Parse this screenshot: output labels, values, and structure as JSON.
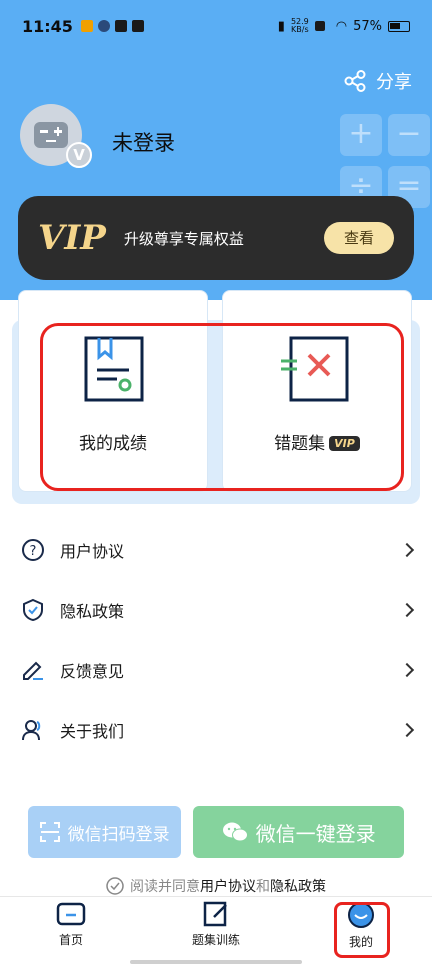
{
  "status": {
    "time": "11:45",
    "speed": "52.9\nKB/s",
    "battery": "57%"
  },
  "header": {
    "share_label": "分享",
    "username": "未登录",
    "avatar_badge": "V"
  },
  "vip_banner": {
    "logo": "VIP",
    "description": "升级尊享专属权益",
    "button": "查看"
  },
  "cards": [
    {
      "label": "我的成绩"
    },
    {
      "label": "错题集",
      "badge": "VIP"
    }
  ],
  "menu": [
    {
      "label": "用户协议"
    },
    {
      "label": "隐私政策"
    },
    {
      "label": "反馈意见"
    },
    {
      "label": "关于我们"
    }
  ],
  "login": {
    "scan_label": "微信扫码登录",
    "onekey_label": "微信一键登录"
  },
  "agreement": {
    "prefix": "阅读并同意",
    "link1": "用户协议",
    "and": "和",
    "link2": "隐私政策"
  },
  "tabbar": [
    {
      "label": "首页"
    },
    {
      "label": "题集训练"
    },
    {
      "label": "我的"
    }
  ],
  "colors": {
    "header_bg": "#5aaef4",
    "vip_bg": "#2c2c2c",
    "vip_gold": "#f5d58b",
    "highlight_red": "#e8231f",
    "wechat_green": "#85d39d"
  }
}
